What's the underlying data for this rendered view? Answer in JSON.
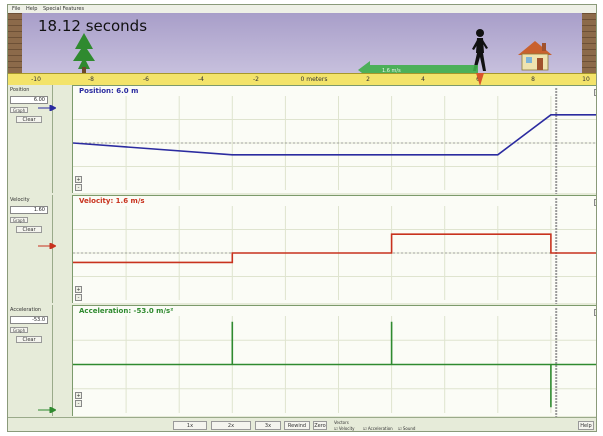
{
  "window": {
    "menu": [
      "File",
      "Help",
      "Special Features"
    ]
  },
  "scene": {
    "time_display": "18.12 seconds",
    "icons": [
      "brick-wall-icon",
      "tree-icon",
      "walking-man-icon",
      "house-icon"
    ],
    "ruler_ticks": [
      "-10",
      "-8",
      "-6",
      "-4",
      "-2",
      "0 meters",
      "2",
      "4",
      "6",
      "8",
      "10"
    ],
    "velocity_arrow_text": "1.6 m/s",
    "colors": {
      "sky": "#b3aad2",
      "ruler": "#f3e36a",
      "arrow": "#3fae4a",
      "brick": "#8c6a4a"
    }
  },
  "panels": {
    "position": {
      "side_label": "Position",
      "value_box": "6.00",
      "title": "Position:   6.0 m",
      "color": "#2b2ba0",
      "mini_buttons": [
        "+",
        "-"
      ],
      "side_buttons": [
        "Graph",
        "Clear"
      ]
    },
    "velocity": {
      "side_label": "Velocity",
      "value_box": "1.60",
      "title": "Velocity:   1.6 m/s",
      "color": "#c8321e",
      "mini_buttons": [
        "+",
        "-"
      ],
      "side_buttons": [
        "Graph",
        "Clear"
      ]
    },
    "acceleration": {
      "side_label": "Acceleration",
      "value_box": "-53.0",
      "title": "Acceleration:   -53.0 m/s²",
      "color": "#2f8a2f",
      "mini_buttons": [
        "+",
        "-"
      ],
      "side_buttons": [
        "Graph",
        "Clear"
      ]
    }
  },
  "chart_data": [
    {
      "type": "line",
      "title": "Position:   6.0 m",
      "x": [
        0,
        3,
        5,
        6,
        8,
        9,
        10
      ],
      "series": [
        {
          "values": [
            0,
            -2.5,
            -2.5,
            -2.5,
            -2.5,
            6,
            6
          ]
        }
      ],
      "ylim": [
        -10,
        10
      ],
      "xlim": [
        0,
        10
      ],
      "grid": true
    },
    {
      "type": "line",
      "title": "Velocity:   1.6 m/s",
      "x": [
        0,
        3,
        3,
        6,
        6,
        9,
        9,
        10
      ],
      "series": [
        {
          "values": [
            -0.8,
            -0.8,
            0,
            0,
            1.6,
            1.6,
            0,
            0
          ]
        }
      ],
      "ylim": [
        -4,
        4
      ],
      "xlim": [
        0,
        10
      ],
      "grid": true
    },
    {
      "type": "line",
      "title": "Acceleration:   -53.0 m/s²",
      "x": [
        0,
        3,
        3,
        3,
        6,
        6,
        6,
        9,
        9,
        9,
        10
      ],
      "series": [
        {
          "values": [
            0,
            0,
            53,
            0,
            0,
            53,
            0,
            0,
            -53,
            0,
            0
          ]
        }
      ],
      "ylim": [
        -60,
        60
      ],
      "xlim": [
        0,
        10
      ],
      "grid": true
    }
  ],
  "footer": {
    "buttons": [
      "1x",
      "2x",
      "3x",
      "Rewind",
      "Zero"
    ],
    "options_label": "Vectors",
    "option_velocity": "Velocity",
    "option_acceleration": "Acceleration",
    "option_sound": "Sound",
    "help": "Help"
  }
}
